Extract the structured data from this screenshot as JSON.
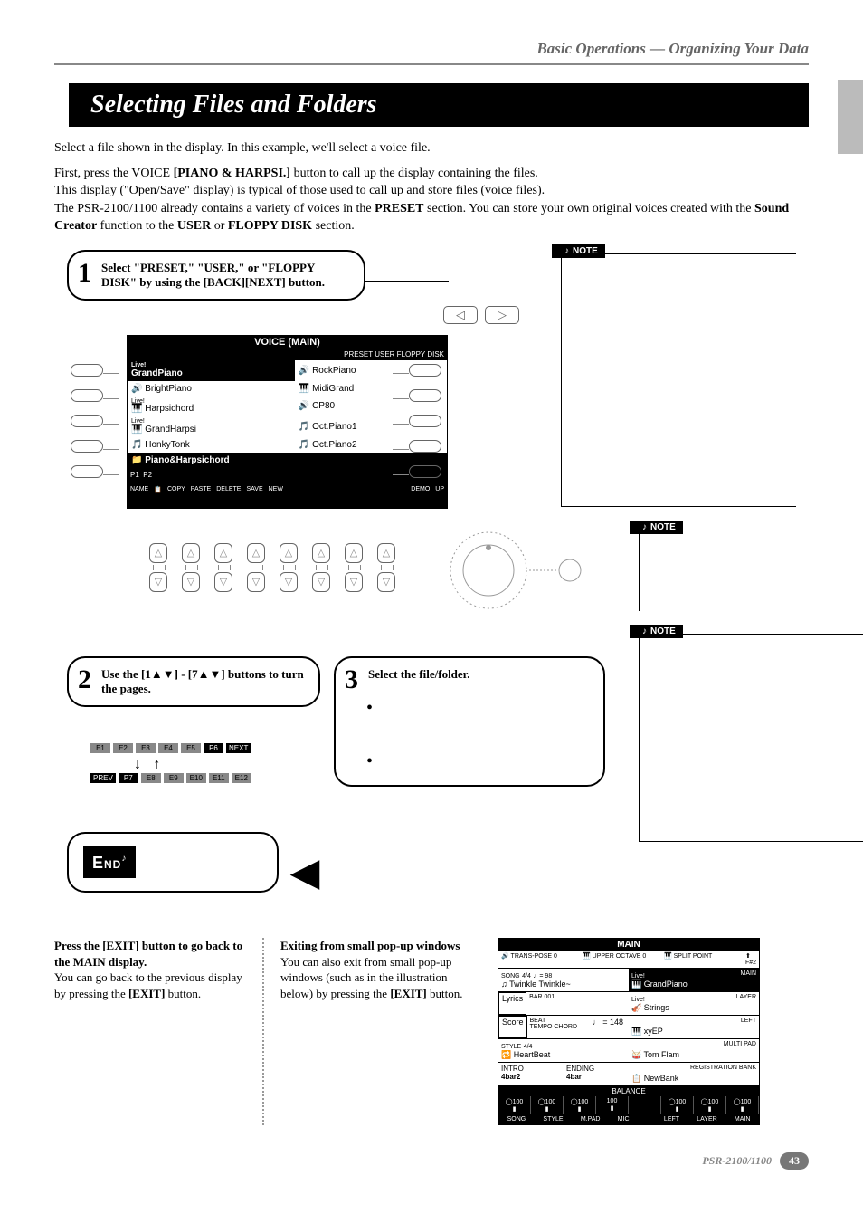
{
  "header": {
    "breadcrumb": "Basic Operations — Organizing Your Data"
  },
  "title": "Selecting Files and Folders",
  "intro": {
    "p1": "Select a file shown in the display. In this example, we'll select a voice file.",
    "p2a": "First, press the VOICE ",
    "p2b": "[PIANO & HARPSI.]",
    "p2c": " button to call up the display containing the files.",
    "p3": "This display (\"Open/Save\" display) is typical of those used to call up and store files (voice files).",
    "p4a": "The PSR-2100/1100 already contains a variety of voices in the ",
    "p4b": "PRESET",
    "p4c": " section. You can store your own original voices created with the ",
    "p4d": "Sound Creator",
    "p4e": " function to the ",
    "p4f": "USER",
    "p4g": " or ",
    "p4h": "FLOPPY DISK",
    "p4i": " section."
  },
  "steps": {
    "s1": {
      "num": "1",
      "text": "Select \"PRESET,\" \"USER,\" or \"FLOPPY DISK\" by using the [BACK][NEXT] button."
    },
    "s2": {
      "num": "2",
      "text": "Use the [1▲▼] - [7▲▼] buttons to turn the pages."
    },
    "s3": {
      "num": "3",
      "text": "Select the file/folder."
    }
  },
  "voice_screen": {
    "title": "VOICE (MAIN)",
    "tabs": "PRESET  USER  FLOPPY DISK",
    "rows": [
      [
        "GrandPiano",
        "RockPiano"
      ],
      [
        "BrightPiano",
        "MidiGrand"
      ],
      [
        "Harpsichord",
        "CP80"
      ],
      [
        "GrandHarpsi",
        "Oct.Piano1"
      ],
      [
        "HonkyTonk",
        "Oct.Piano2"
      ]
    ],
    "live_rows": [
      0,
      2,
      3
    ],
    "category": "Piano&Harpsichord",
    "footer_labels": [
      "P1",
      "P2",
      "NAME",
      "COPY",
      "PASTE",
      "DELETE",
      "SAVE",
      "NEW",
      "DEMO",
      "UP"
    ]
  },
  "tab_strip": {
    "row1": [
      "E1",
      "E2",
      "E3",
      "E4",
      "E5",
      "P6",
      "NEXT"
    ],
    "row2": [
      "PREV",
      "P7",
      "E8",
      "E9",
      "E10",
      "E11",
      "E12"
    ]
  },
  "notes": {
    "label": "NOTE"
  },
  "end": {
    "badge": "END",
    "text_bold": "Press the [EXIT] button to go back to the MAIN display.",
    "text": "You can go back to the previous display by pressing the ",
    "exit": "[EXIT]",
    "text2": " button."
  },
  "popup": {
    "heading": "Exiting from small pop-up windows",
    "text1": "You can also exit from small pop-up windows (such as in the illustration below) by pressing the ",
    "exit": "[EXIT]",
    "text2": " button."
  },
  "main_screen": {
    "title": "MAIN",
    "top_items": [
      "TRANS-POSE 0",
      "UPPER OCTAVE 0",
      "SPLIT POINT",
      "F#2"
    ],
    "song_label": "SONG",
    "song_sig": "4/4",
    "song_tempo": "♩= 98",
    "song": "Twinkle Twinkle~",
    "voice_tag": "Live!",
    "voice": "GrandPiano",
    "voice_side": "MAIN",
    "lyrics": "Lyrics",
    "bar": "BAR",
    "bar_val": "001",
    "layer_tag": "Live!",
    "layer": "Strings",
    "layer_side": "LAYER",
    "score": "Score",
    "beat": "BEAT",
    "tempo_lbl": "TEMPO CHORD",
    "tempo": "♩ = 148",
    "left": "xyEP",
    "left_side": "LEFT",
    "style_lbl": "STYLE",
    "style_sig": "4/4",
    "style": "HeartBeat",
    "mpad": "Tom Flam",
    "mpad_side": "MULTI PAD",
    "intro": "INTRO",
    "intro_v": "4bar2",
    "ending": "ENDING",
    "ending_v": "4bar",
    "reg": "REGISTRATION BANK",
    "reg_v": "NewBank",
    "balance": "BALANCE",
    "bal_vals": [
      "100",
      "100",
      "100",
      "100",
      "",
      "100",
      "100",
      "100"
    ],
    "bal_lbls": [
      "SONG",
      "STYLE",
      "M.PAD",
      "MIC",
      "",
      "LEFT",
      "LAYER",
      "MAIN"
    ]
  },
  "footer": {
    "model": "PSR-2100/1100",
    "page": "43"
  }
}
